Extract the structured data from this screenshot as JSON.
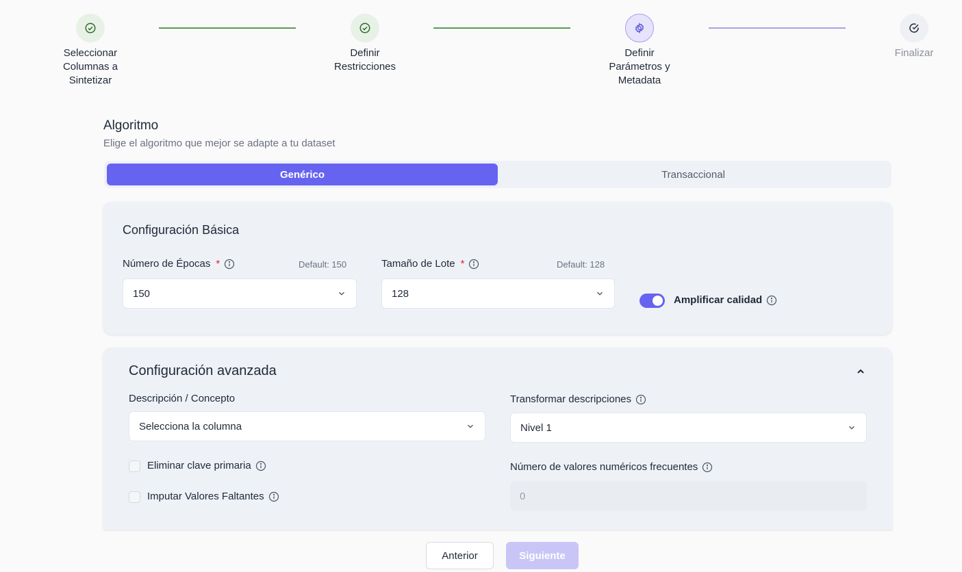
{
  "stepper": {
    "steps": [
      {
        "label": "Seleccionar\nColumnas a\nSintetizar",
        "state": "done",
        "icon": "check-circle-icon"
      },
      {
        "label": "Definir\nRestricciones",
        "state": "done",
        "icon": "check-circle-icon"
      },
      {
        "label": "Definir\nParámetros y\nMetadata",
        "state": "active",
        "icon": "gear-icon"
      },
      {
        "label": "Finalizar",
        "state": "pending",
        "icon": "check-circle-icon"
      }
    ]
  },
  "algorithm": {
    "title": "Algoritmo",
    "subtitle": "Elige el algoritmo que mejor se adapte a tu dataset",
    "tabs": [
      {
        "label": "Genérico",
        "active": true
      },
      {
        "label": "Transaccional",
        "active": false
      }
    ]
  },
  "basic": {
    "title": "Configuración Básica",
    "epochs": {
      "label": "Número de Épocas",
      "required_mark": "*",
      "default_note": "Default: 150",
      "value": "150"
    },
    "batch": {
      "label": "Tamaño de Lote",
      "required_mark": "*",
      "default_note": "Default: 128",
      "value": "128"
    },
    "amplify": {
      "label": "Amplificar calidad",
      "enabled": true
    }
  },
  "advanced": {
    "title": "Configuración avanzada",
    "description": {
      "label": "Descripción / Concepto",
      "value": "Selecciona la columna"
    },
    "transform": {
      "label": "Transformar descripciones",
      "value": "Nivel 1"
    },
    "remove_pk": {
      "label": "Eliminar clave primaria",
      "checked": false
    },
    "impute": {
      "label": "Imputar Valores Faltantes",
      "checked": false
    },
    "frequent": {
      "label": "Número de valores numéricos frecuentes",
      "placeholder": "0"
    }
  },
  "footer": {
    "prev_label": "Anterior",
    "next_label": "Siguiente"
  },
  "colors": {
    "accent": "#6663f1",
    "accent_disabled": "#c9c6f7",
    "done_green": "#5a9a52",
    "required_red": "#dc2626"
  }
}
